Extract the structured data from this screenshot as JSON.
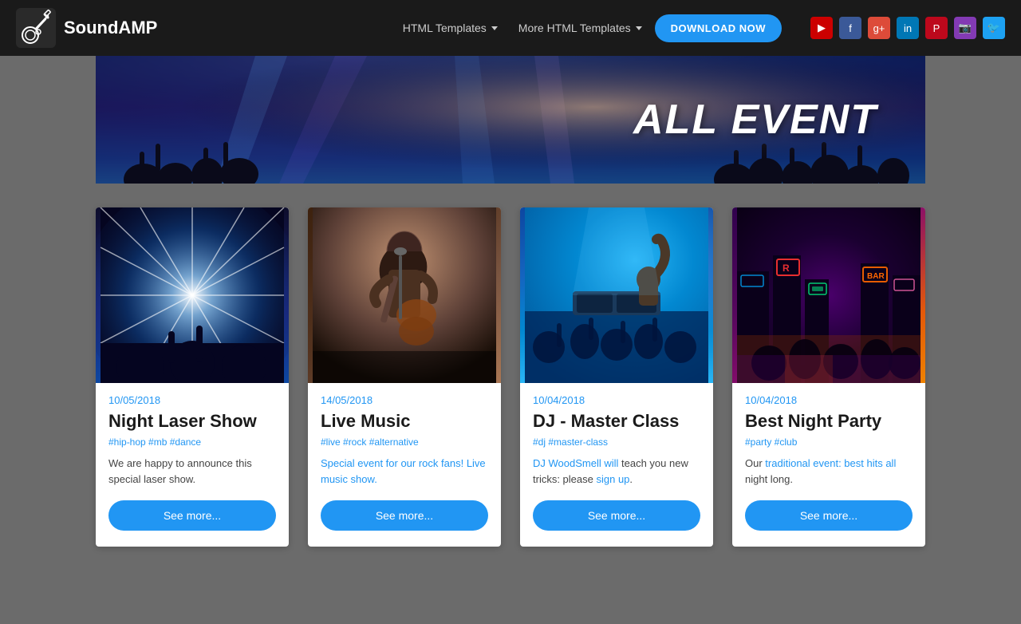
{
  "brand": {
    "name": "SoundAMP"
  },
  "navbar": {
    "nav_item_1": "HTML Templates",
    "nav_item_2": "More HTML Templates",
    "download_button": "DOWNLOAD NOW"
  },
  "social": {
    "icons": [
      "YT",
      "f",
      "G+",
      "in",
      "P",
      "IG",
      "tw"
    ]
  },
  "hero": {
    "title": "ALL EVENT"
  },
  "events": [
    {
      "date": "10/05/2018",
      "title": "Night Laser Show",
      "tags": "#hip-hop #mb #dance",
      "description": "We are happy to announce this special laser show.",
      "button": "See more...",
      "img_label": "laser-show-image"
    },
    {
      "date": "14/05/2018",
      "title": "Live Music",
      "tags": "#live #rock #alternative",
      "description": "Special event for our rock fans! Live music show.",
      "button": "See more...",
      "img_label": "live-music-image",
      "desc_is_link": true
    },
    {
      "date": "10/04/2018",
      "title": "DJ - Master Class",
      "tags": "#dj #master-class",
      "description_parts": {
        "before": "DJ WoodSmell will",
        "link1": " teach you",
        "middle": " new tricks: please",
        "link2": " sign up",
        "after": "."
      },
      "button": "See more...",
      "img_label": "dj-masterclass-image"
    },
    {
      "date": "10/04/2018",
      "title": "Best Night Party",
      "tags": "#party #club",
      "description_parts": {
        "before": "Our",
        "link1": " traditional event: best hits all",
        "after": " night long."
      },
      "button": "See more...",
      "img_label": "night-party-image"
    }
  ]
}
